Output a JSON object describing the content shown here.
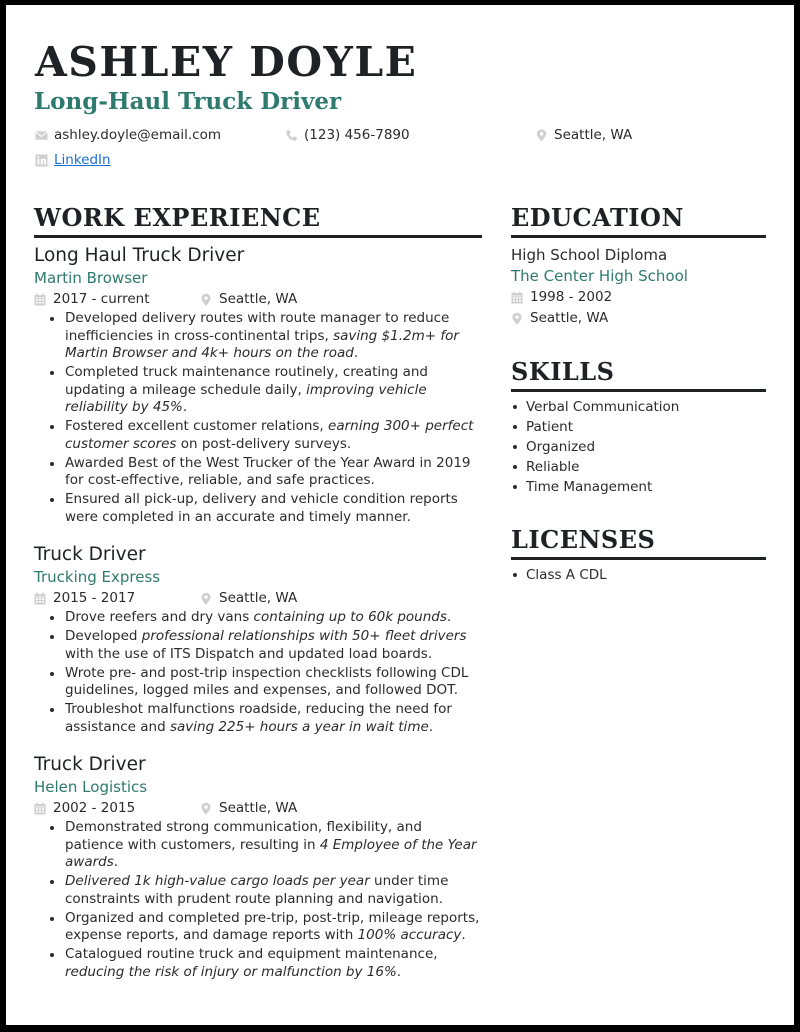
{
  "header": {
    "name": "ASHLEY DOYLE",
    "title": "Long-Haul Truck Driver",
    "contact": {
      "email": "ashley.doyle@email.com",
      "phone": "(123) 456-7890",
      "location": "Seattle, WA",
      "linkedin_label": "LinkedIn"
    },
    "icons": {
      "email": "envelope-icon",
      "phone": "phone-icon",
      "location": "map-pin-icon",
      "linkedin": "linkedin-icon"
    }
  },
  "colors": {
    "accent": "#2e7a6e",
    "text": "#2b2b2b",
    "heading": "#1f2124",
    "link": "#1a6fd1",
    "icon": "#c8c8c8"
  },
  "work": {
    "heading": "WORK EXPERIENCE",
    "jobs": [
      {
        "title": "Long Haul Truck Driver",
        "company": "Martin Browser",
        "dates": "2017 - current",
        "location": "Seattle, WA",
        "bullets": [
          [
            {
              "t": "Developed delivery routes with route manager to reduce inefficiencies in cross-continental trips, "
            },
            {
              "t": "saving $1.2m+ for Martin Browser and 4k+ hours on the road",
              "i": true
            },
            {
              "t": "."
            }
          ],
          [
            {
              "t": "Completed truck maintenance routinely, creating and updating a mileage schedule daily, "
            },
            {
              "t": "improving vehicle reliability by 45%",
              "i": true
            },
            {
              "t": "."
            }
          ],
          [
            {
              "t": "Fostered excellent customer relations, "
            },
            {
              "t": "earning 300+ perfect customer scores",
              "i": true
            },
            {
              "t": " on post-delivery surveys."
            }
          ],
          [
            {
              "t": "Awarded Best of the West Trucker of the Year Award in 2019 for cost-effective, reliable, and safe practices."
            }
          ],
          [
            {
              "t": "Ensured all pick-up, delivery and vehicle condition reports were completed in an accurate and timely manner."
            }
          ]
        ]
      },
      {
        "title": "Truck Driver",
        "company": "Trucking Express",
        "dates": "2015 - 2017",
        "location": "Seattle, WA",
        "bullets": [
          [
            {
              "t": "Drove reefers and dry vans "
            },
            {
              "t": "containing up to 60k pounds",
              "i": true
            },
            {
              "t": "."
            }
          ],
          [
            {
              "t": "Developed "
            },
            {
              "t": "professional relationships with 50+ fleet drivers",
              "i": true
            },
            {
              "t": " with the use of ITS Dispatch and updated load boards."
            }
          ],
          [
            {
              "t": "Wrote pre- and post-trip inspection checklists following CDL guidelines, logged miles and expenses, and followed DOT."
            }
          ],
          [
            {
              "t": "Troubleshot malfunctions roadside, reducing the need for assistance and "
            },
            {
              "t": "saving 225+ hours a year in wait time",
              "i": true
            },
            {
              "t": "."
            }
          ]
        ]
      },
      {
        "title": "Truck Driver",
        "company": "Helen Logistics",
        "dates": "2002 - 2015",
        "location": "Seattle, WA",
        "bullets": [
          [
            {
              "t": "Demonstrated strong communication, flexibility, and patience with customers, resulting in "
            },
            {
              "t": "4 Employee of the Year awards",
              "i": true
            },
            {
              "t": "."
            }
          ],
          [
            {
              "t": "Delivered 1k high-value cargo loads per year",
              "i": true
            },
            {
              "t": " under time constraints with prudent route planning and navigation."
            }
          ],
          [
            {
              "t": "Organized and completed pre-trip, post-trip, mileage reports, expense reports, and damage reports with "
            },
            {
              "t": "100% accuracy",
              "i": true
            },
            {
              "t": "."
            }
          ],
          [
            {
              "t": "Catalogued routine truck and equipment maintenance, "
            },
            {
              "t": "reducing the risk of injury or malfunction by 16%",
              "i": true
            },
            {
              "t": "."
            }
          ]
        ]
      }
    ]
  },
  "education": {
    "heading": "EDUCATION",
    "degree": "High School Diploma",
    "school": "The Center High School",
    "dates": "1998 - 2002",
    "location": "Seattle, WA"
  },
  "skills": {
    "heading": "SKILLS",
    "items": [
      "Verbal Communication",
      "Patient",
      "Organized",
      "Reliable",
      "Time Management"
    ]
  },
  "licenses": {
    "heading": "LICENSES",
    "items": [
      "Class A CDL"
    ]
  }
}
